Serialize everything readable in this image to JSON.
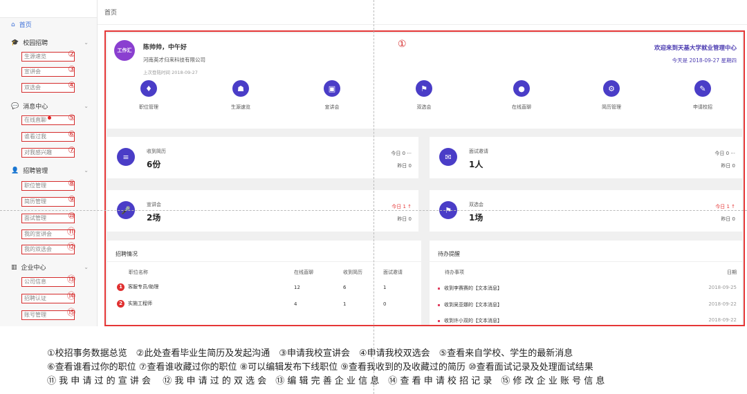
{
  "breadcrumb": "首页",
  "sidebar": {
    "home": "首页",
    "groups": [
      {
        "label": "校园招聘",
        "icon": "graduation-cap-icon"
      },
      {
        "label": "消息中心",
        "icon": "chat-icon"
      },
      {
        "label": "招聘管理",
        "icon": "user-icon"
      },
      {
        "label": "企业中心",
        "icon": "building-icon"
      }
    ],
    "items": [
      {
        "label": "生源速览",
        "num": "②"
      },
      {
        "label": "宣讲会",
        "num": "③"
      },
      {
        "label": "双选会",
        "num": "④"
      },
      {
        "label": "在线直聊",
        "num": "⑤"
      },
      {
        "label": "谁看过我",
        "num": "⑥"
      },
      {
        "label": "对我感兴趣",
        "num": "⑦"
      },
      {
        "label": "职位管理",
        "num": "⑧"
      },
      {
        "label": "简历管理",
        "num": "⑨"
      },
      {
        "label": "面试管理",
        "num": "⑩"
      },
      {
        "label": "我的宣讲会",
        "num": "⑪"
      },
      {
        "label": "我的双选会",
        "num": "⑫"
      },
      {
        "label": "公司信息",
        "num": "⑬"
      },
      {
        "label": "招聘认证",
        "num": "⑭"
      },
      {
        "label": "账号管理",
        "num": "⑮"
      }
    ]
  },
  "welcome": {
    "logo_text": "工作汇",
    "greeting": "陈帅帅，中午好",
    "company": "河南英才归来科技有限公司",
    "last_login": "上次登陆时间 2018-09-27",
    "marker": "①",
    "title": "欢迎来到天基大学就业管理中心",
    "today": "今天是 2018-09-27 星期四",
    "quick": [
      {
        "label": "职位管理",
        "icon": "tie-icon"
      },
      {
        "label": "生源速览",
        "icon": "students-icon"
      },
      {
        "label": "宣讲会",
        "icon": "presentation-icon"
      },
      {
        "label": "双选会",
        "icon": "flag-icon"
      },
      {
        "label": "在线直聊",
        "icon": "chat-bubble-icon"
      },
      {
        "label": "简历管理",
        "icon": "gear-icon"
      },
      {
        "label": "申请校招",
        "icon": "edit-doc-icon"
      }
    ]
  },
  "stats": [
    {
      "label": "收到简历",
      "value": "6份",
      "today": "今日 0 ···",
      "yesterday": "昨日 0",
      "icon": "document-icon"
    },
    {
      "label": "面试邀请",
      "value": "1人",
      "today": "今日 0 ···",
      "yesterday": "昨日 0",
      "icon": "envelope-icon"
    },
    {
      "label": "宣讲会",
      "value": "2场",
      "today": "今日 1 ↑",
      "yesterday": "昨日 0",
      "icon": "microphone-icon"
    },
    {
      "label": "双选会",
      "value": "1场",
      "today": "今日 1 ↑",
      "yesterday": "昨日 0",
      "icon": "flag-icon"
    }
  ],
  "recruit": {
    "title": "招聘情况",
    "headers": [
      "职位名称",
      "在线直聊",
      "收到简历",
      "面试邀请"
    ],
    "rows": [
      {
        "rank": "1",
        "name": "客服专员/助理",
        "chat": "12",
        "resume": "6",
        "interview": "1"
      },
      {
        "rank": "2",
        "name": "实施工程师",
        "chat": "4",
        "resume": "1",
        "interview": "0"
      }
    ]
  },
  "todo": {
    "title": "待办提醒",
    "headers": [
      "待办事项",
      "日期"
    ],
    "rows": [
      {
        "item": "收到李赛赛的【文本消息】",
        "date": "2018-09-25"
      },
      {
        "item": "收到吴亚娜的【文本消息】",
        "date": "2018-09-22"
      },
      {
        "item": "收到许小双的【文本消息】",
        "date": "2018-09-22"
      }
    ]
  },
  "footer": [
    "①校招事务数据总览　②此处查看毕业生简历及发起沟通　③申请我校宣讲会　④申请我校双选会　⑤查看来自学校、学生的最新消息",
    "⑥查看谁看过你的职位 ⑦查看谁收藏过你的职位 ⑧可以编辑发布下线职位 ⑨查看我收到的及收藏过的简历 ⑩查看面试记录及处理面试结果",
    "⑪ 我 申 请 过 的 宣 讲 会　 ⑫ 我 申 请 过 的 双 选 会　⑬ 编 辑 完 善 企 业 信 息　⑭ 查 看 申 请 校 招 记 录　⑮ 修 改 企 业 账 号 信 息"
  ]
}
